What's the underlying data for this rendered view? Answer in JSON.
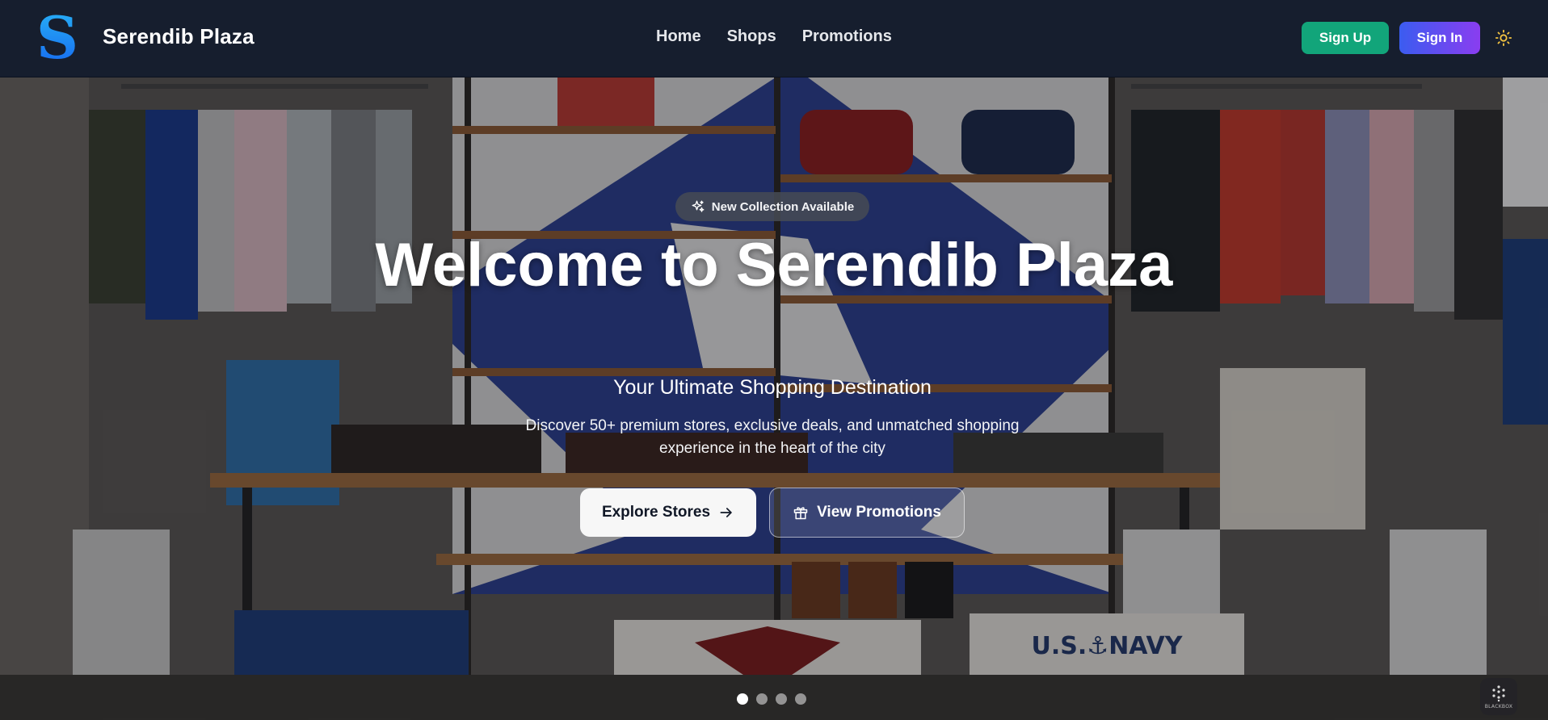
{
  "navbar": {
    "logo_icon": "serendib-s-logo",
    "brand": "Serendib Plaza",
    "links": [
      {
        "label": "Home"
      },
      {
        "label": "Shops"
      },
      {
        "label": "Promotions"
      }
    ],
    "signup_label": "Sign Up",
    "signin_label": "Sign In",
    "theme_icon": "sun-icon",
    "signup_color": "#12a57a",
    "signin_gradient": [
      "#3b5cf0",
      "#8a3df0"
    ]
  },
  "hero": {
    "badge_icon": "sparkles-icon",
    "badge": "New Collection Available",
    "title": "Welcome to Serendib Plaza",
    "subtitle": "Your Ultimate Shopping Destination",
    "description": "Discover 50+ premium stores, exclusive deals, and unmatched shopping experience in the heart of the city",
    "primary_button": {
      "label": "Explore Stores",
      "icon": "arrow-right-icon"
    },
    "secondary_button": {
      "label": "View Promotions",
      "icon": "gift-icon"
    },
    "slides_total": 4,
    "active_slide": 1,
    "background": "clothing-store-interior-photo"
  },
  "corner_widget": {
    "label": "BLACKBOX",
    "icon": "blackbox-icon"
  }
}
